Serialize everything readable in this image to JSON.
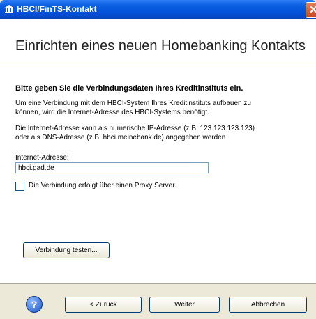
{
  "window": {
    "title": "HBCI/FinTS-Kontakt",
    "header_title": "Einrichten eines neuen Homebanking Kontakts"
  },
  "content": {
    "heading": "Bitte geben Sie die Verbindungsdaten Ihres Kreditinstituts ein.",
    "paragraph1_line1": "Um eine Verbindung mit dem HBCI-System Ihres Kreditinstituts aufbauen zu",
    "paragraph1_line2": "können, wird die Internet-Adresse des HBCI-Systems benötigt.",
    "paragraph2_line1": "Die Internet-Adresse kann als numerische IP-Adresse (z.B. 123.123.123.123)",
    "paragraph2_line2": "oder als DNS-Adresse (z.B. hbci.meinebank.de) angegeben werden.",
    "address_label": "Internet-Adresse:",
    "address_value": "hbci.gad.de",
    "proxy_label": "Die Verbindung erfolgt über einen Proxy Server.",
    "proxy_checked": false,
    "test_button": "Verbindung testen..."
  },
  "footer": {
    "back": "< Zurück",
    "next": "Weiter",
    "cancel": "Abbrechen",
    "help_icon": "help-icon"
  },
  "colors": {
    "titlebar": "#0a5fe0",
    "accent": "#003c74"
  }
}
